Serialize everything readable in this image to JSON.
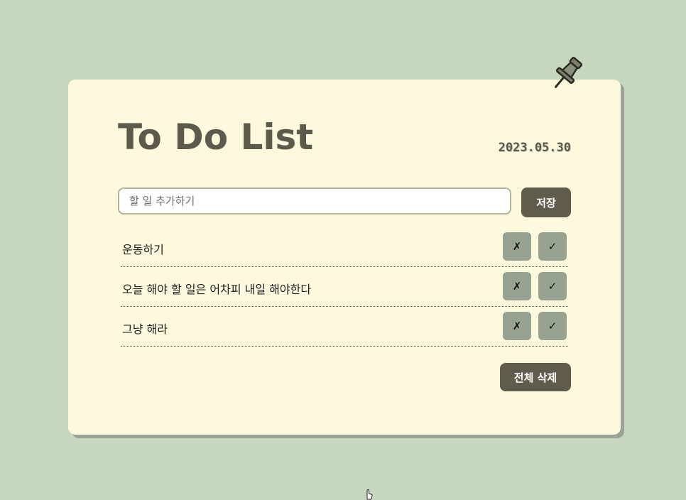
{
  "app": {
    "title": "To Do List",
    "date": "2023.05.30"
  },
  "input": {
    "placeholder": "할 일 추가하기",
    "value": ""
  },
  "buttons": {
    "save_label": "저장",
    "clear_all_label": "전체 삭제",
    "delete_symbol": "✗",
    "done_symbol": "✓"
  },
  "todos": [
    {
      "text": "운동하기"
    },
    {
      "text": "오늘 해야 할 일은 어차피 내일 해야한다"
    },
    {
      "text": "그냥 해라"
    }
  ],
  "icons": {
    "pin": "pushpin-icon",
    "cursor": "hand-pointer-icon"
  },
  "colors": {
    "background": "#c6d7bd",
    "card": "#fdf9dc",
    "accent": "#5f5c4b",
    "row_button": "#97a290"
  }
}
